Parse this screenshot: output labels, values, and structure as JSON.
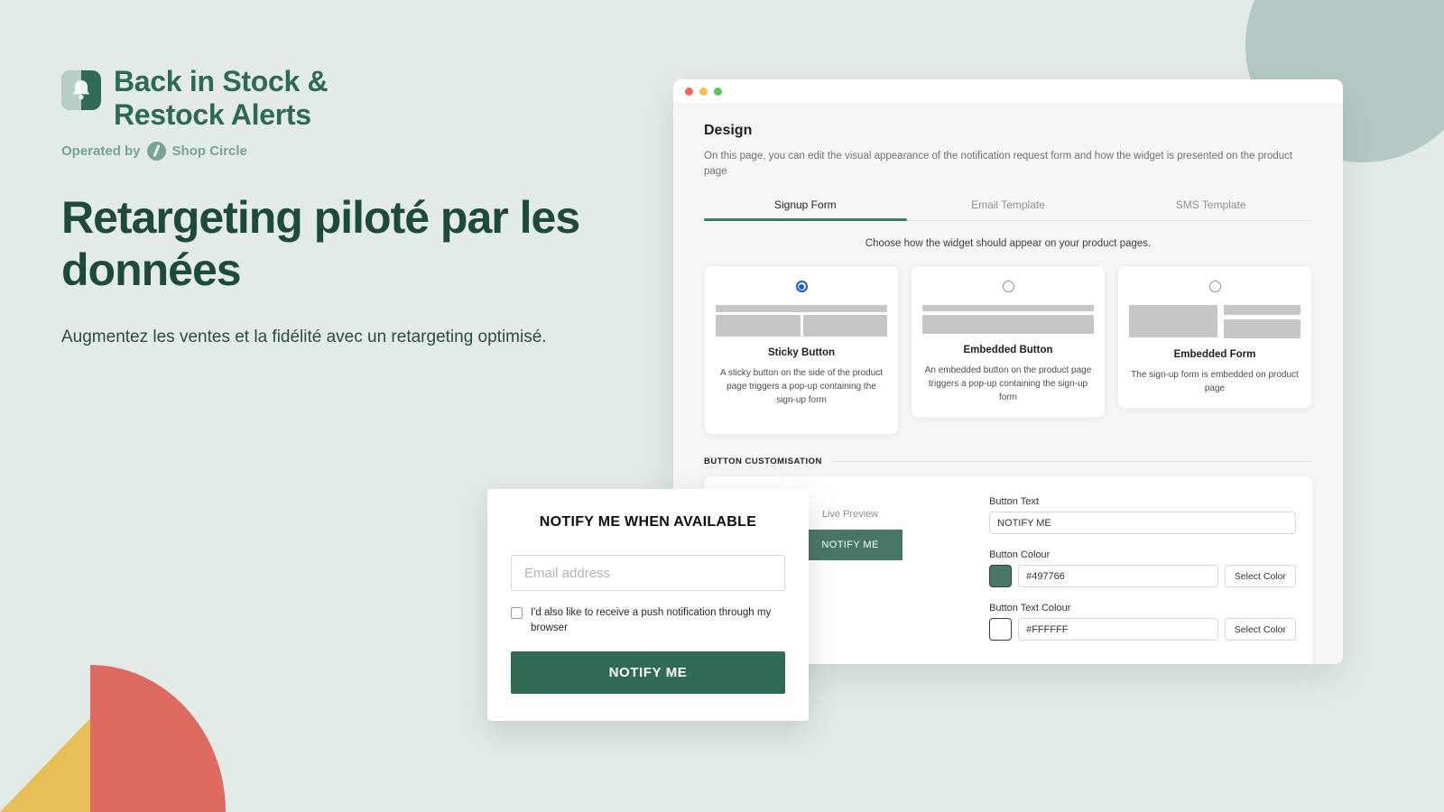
{
  "brand": {
    "title_line1": "Back in Stock &",
    "title_line2": "Restock Alerts",
    "operated_by": "Operated by",
    "operator_name": "Shop Circle",
    "logo_icon": "bell-icon",
    "operator_icon": "shop-circle-logo-icon"
  },
  "hero": {
    "headline": "Retargeting piloté par les données",
    "subhead": "Augmentez les ventes et la fidélité avec un retargeting optimisé."
  },
  "browser": {
    "traffic_lights": [
      "close-dot",
      "minimize-dot",
      "maximize-dot"
    ]
  },
  "app": {
    "page_title": "Design",
    "page_description": "On this page, you can edit the visual appearance of the notification request form and how the widget is presented on the product page",
    "tabs": [
      {
        "label": "Signup Form",
        "active": true
      },
      {
        "label": "Email Template",
        "active": false
      },
      {
        "label": "SMS Template",
        "active": false
      }
    ],
    "choose_line": "Choose how the widget should appear on your product pages.",
    "options": [
      {
        "name": "Sticky Button",
        "description": "A sticky button on the side of the product page triggers a pop-up containing the sign-up form",
        "selected": true
      },
      {
        "name": "Embedded Button",
        "description": "An embedded button on the product page triggers a pop-up containing the sign-up form",
        "selected": false
      },
      {
        "name": "Embedded Form",
        "description": "The sign-up form is embedded on product page",
        "selected": false
      }
    ],
    "section_label": "BUTTON CUSTOMISATION",
    "live_preview_label": "Live Preview",
    "preview_button_text": "NOTIFY ME",
    "fields": {
      "button_text_label": "Button Text",
      "button_text_value": "NOTIFY ME",
      "button_colour_label": "Button Colour",
      "button_colour_value": "#497766",
      "button_text_colour_label": "Button Text Colour",
      "button_text_colour_value": "#FFFFFF",
      "select_color_label": "Select Color"
    }
  },
  "popup": {
    "title": "NOTIFY ME WHEN AVAILABLE",
    "email_placeholder": "Email address",
    "checkbox_label": "I'd also like to receive a push notification through my browser",
    "submit_label": "NOTIFY ME"
  },
  "colors": {
    "background": "#e3ebe7",
    "brand_green": "#2d6a50",
    "headline_green": "#1d4b38",
    "accent_green": "#497766",
    "popup_green": "#2f6b52",
    "deco_green_circle": "#b4c9c4",
    "deco_yellow": "#e8bf56",
    "deco_red": "#dd6a60",
    "tab_underline": "#3f7a62",
    "radio_blue": "#1b5ed0"
  }
}
